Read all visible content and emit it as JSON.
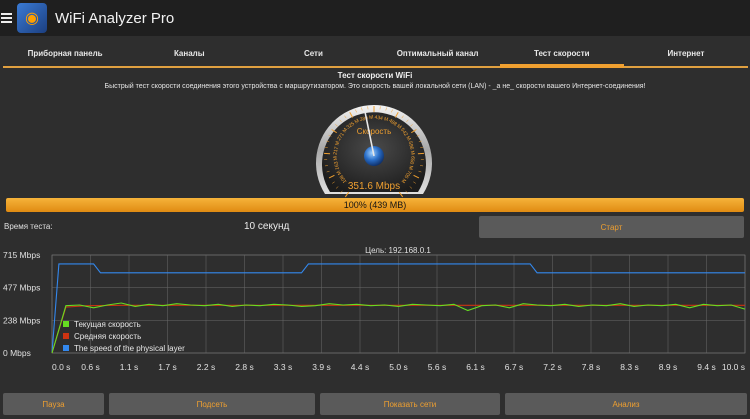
{
  "app": {
    "title": "WiFi Analyzer Pro"
  },
  "tabs": [
    {
      "label": "Приборная панель",
      "active": false
    },
    {
      "label": "Каналы",
      "active": false
    },
    {
      "label": "Сети",
      "active": false
    },
    {
      "label": "Оптимальный канал",
      "active": false
    },
    {
      "label": "Тест скорости",
      "active": true
    },
    {
      "label": "Интернет",
      "active": false
    }
  ],
  "speedtest": {
    "title": "Тест скорости WiFi",
    "description": "Быстрый тест скорости соединения этого устройства с маршрутизатором. Это скорость вашей локальной сети (LAN) - _а не_ скорости вашего Интернет-соединения!",
    "gauge": {
      "label": "Скорость",
      "reading": "351.6 Mbps",
      "value": 351.6,
      "max": 542,
      "ticks": [
        "108 M",
        "163 M",
        "217 M",
        "271 M",
        "325 M",
        "380 M",
        "434 M",
        "488 M",
        "542 M",
        "596 M",
        "650 M",
        "705 M"
      ]
    },
    "progress": {
      "text": "100% (439 MB)",
      "percent": 100
    },
    "test_time_label": "Время теста:",
    "test_time_value": "10 секунд",
    "start_label": "Старт"
  },
  "chart_data": {
    "type": "line",
    "title": "Цель: 192.168.0.1",
    "y_ticks": [
      "715 Mbps",
      "477 Mbps",
      "238 Mbps",
      "0 Mbps"
    ],
    "ylim": [
      0,
      715
    ],
    "x_ticks": [
      "0.0 s",
      "0.6 s",
      "1.1 s",
      "1.7 s",
      "2.2 s",
      "2.8 s",
      "3.3 s",
      "3.9 s",
      "4.4 s",
      "5.0 s",
      "5.6 s",
      "6.1 s",
      "6.7 s",
      "7.2 s",
      "7.8 s",
      "8.3 s",
      "8.9 s",
      "9.4 s",
      "10.0 s"
    ],
    "xlim": [
      0,
      10
    ],
    "series": [
      {
        "name": "Текущая скорость",
        "color": "#66dd22",
        "x": [
          0,
          0.2,
          0.4,
          0.6,
          0.8,
          1.0,
          1.2,
          1.4,
          1.6,
          1.8,
          2.0,
          2.2,
          2.4,
          2.6,
          2.8,
          3.0,
          3.2,
          3.4,
          3.6,
          3.8,
          4.0,
          4.2,
          4.4,
          4.6,
          4.8,
          5.0,
          5.2,
          5.4,
          5.6,
          5.8,
          6.0,
          6.2,
          6.4,
          6.6,
          6.8,
          7.0,
          7.2,
          7.4,
          7.6,
          7.8,
          8.0,
          8.2,
          8.4,
          8.6,
          8.8,
          9.0,
          9.2,
          9.4,
          9.6,
          9.8,
          10.0
        ],
        "values": [
          0,
          345,
          350,
          330,
          350,
          365,
          340,
          355,
          345,
          360,
          350,
          345,
          355,
          340,
          350,
          345,
          355,
          350,
          340,
          345,
          360,
          350,
          355,
          345,
          350,
          340,
          355,
          350,
          345,
          355,
          310,
          345,
          350,
          330,
          360,
          350,
          345,
          355,
          340,
          350,
          345,
          360,
          340,
          350,
          345,
          355,
          330,
          355,
          345,
          350,
          320
        ]
      },
      {
        "name": "Средняя скорость",
        "color": "#cc3311",
        "x": [
          0,
          0.2,
          0.5,
          1.0,
          2.0,
          3.0,
          4.0,
          5.0,
          6.0,
          7.0,
          8.0,
          9.0,
          10.0
        ],
        "values": [
          0,
          335,
          345,
          348,
          348,
          348,
          348,
          348,
          348,
          348,
          348,
          348,
          348
        ]
      },
      {
        "name": "The speed of the physical layer",
        "color": "#3388ee",
        "x": [
          0,
          0.1,
          0.6,
          0.7,
          3.6,
          3.7,
          6.9,
          7.0,
          10.0
        ],
        "values": [
          0,
          650,
          650,
          585,
          585,
          650,
          650,
          585,
          585
        ]
      }
    ]
  },
  "buttons": {
    "pause": "Пауза",
    "connect": "Подсеть",
    "show_networks": "Показать сети",
    "analysis": "Анализ"
  }
}
